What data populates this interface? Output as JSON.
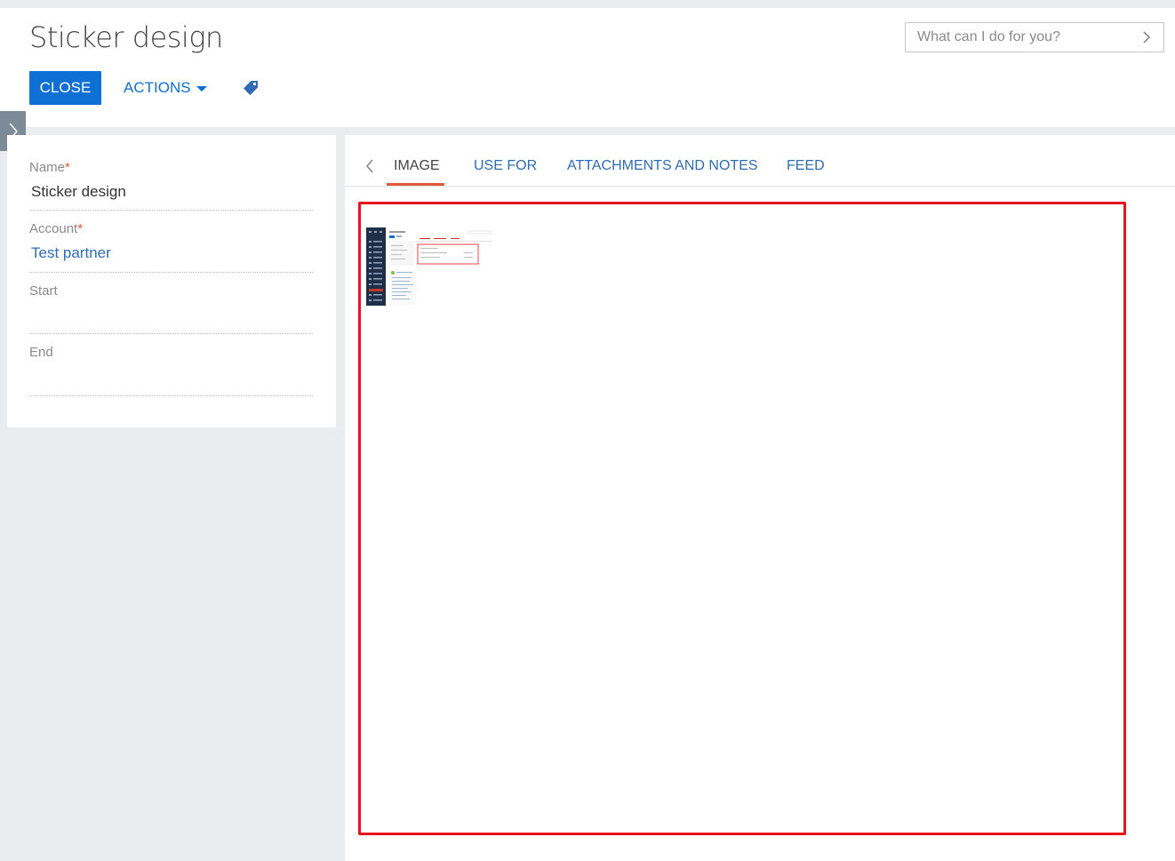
{
  "header": {
    "title": "Sticker design",
    "close_label": "CLOSE",
    "actions_label": "ACTIONS",
    "search_placeholder": "What can I do for you?"
  },
  "form": {
    "fields": [
      {
        "label": "Name",
        "required": true,
        "value": "Sticker design",
        "is_link": false
      },
      {
        "label": "Account",
        "required": true,
        "value": "Test partner",
        "is_link": true
      },
      {
        "label": "Start",
        "required": false,
        "value": "",
        "is_link": false
      },
      {
        "label": "End",
        "required": false,
        "value": "",
        "is_link": false
      }
    ]
  },
  "tabs": [
    {
      "label": "IMAGE",
      "active": true
    },
    {
      "label": "USE FOR",
      "active": false
    },
    {
      "label": "ATTACHMENTS AND NOTES",
      "active": false
    },
    {
      "label": "FEED",
      "active": false
    }
  ],
  "colors": {
    "primary": "#0e6fd4",
    "link": "#2f6cb5",
    "active_tab_underline": "#e05a3a",
    "highlight_frame": "#e8141b",
    "background": "#eaeced"
  }
}
